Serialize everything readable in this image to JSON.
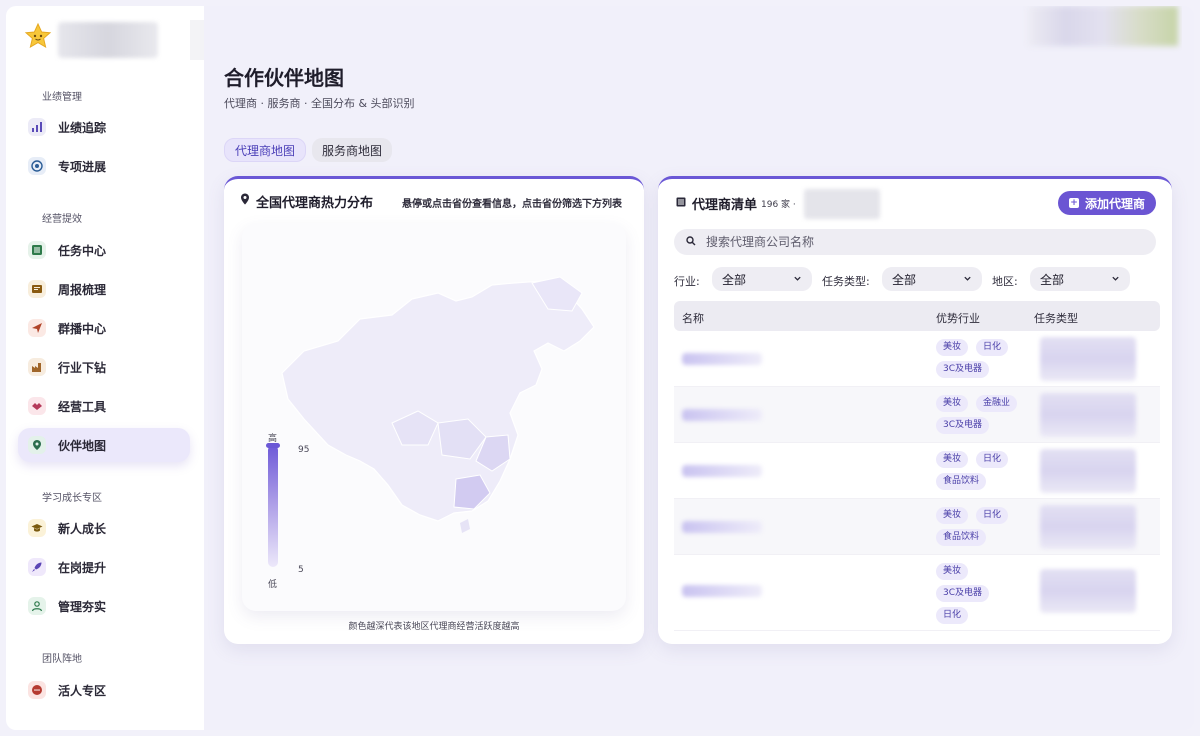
{
  "sidebar": {
    "sections": [
      {
        "label": "业绩管理"
      },
      {
        "label": "经营提效"
      },
      {
        "label": "学习成长专区"
      },
      {
        "label": "团队阵地"
      }
    ],
    "items": [
      {
        "label": "业绩追踪",
        "icon": "bar-chart-icon"
      },
      {
        "label": "专项进展",
        "icon": "target-icon"
      },
      {
        "label": "任务中心",
        "icon": "list-icon"
      },
      {
        "label": "周报梳理",
        "icon": "report-icon"
      },
      {
        "label": "群播中心",
        "icon": "send-icon"
      },
      {
        "label": "行业下钻",
        "icon": "factory-icon"
      },
      {
        "label": "经营工具",
        "icon": "handshake-icon"
      },
      {
        "label": "伙伴地图",
        "icon": "pin-icon"
      },
      {
        "label": "新人成长",
        "icon": "graduation-icon"
      },
      {
        "label": "在岗提升",
        "icon": "rocket-icon"
      },
      {
        "label": "管理夯实",
        "icon": "users-icon"
      },
      {
        "label": "活人专区",
        "icon": "chat-icon"
      }
    ],
    "active_item": "伙伴地图"
  },
  "header": {
    "title": "合作伙伴地图",
    "subtitle": "代理商 · 服务商 · 全国分布 & 头部识别"
  },
  "tabs": [
    {
      "label": "代理商地图",
      "active": true
    },
    {
      "label": "服务商地图",
      "active": false
    }
  ],
  "map_card": {
    "title": "全国代理商热力分布",
    "hint": "悬停或点击省份查看信息，点击省份筛选下方列表",
    "legend_high": "高",
    "legend_low": "低",
    "legend_max": "95",
    "legend_min": "5",
    "footer": "颜色越深代表该地区代理商经营活跃度越高"
  },
  "list_card": {
    "title": "代理商清单",
    "count": "196 家 ·",
    "add_button": "添加代理商",
    "search_placeholder": "搜索代理商公司名称",
    "filters": [
      {
        "label": "行业:",
        "value": "全部"
      },
      {
        "label": "任务类型:",
        "value": "全部"
      },
      {
        "label": "地区:",
        "value": "全部"
      }
    ],
    "columns": [
      "名称",
      "优势行业",
      "任务类型"
    ],
    "rows": [
      {
        "tags": [
          "美妆",
          "日化",
          "3C及电器"
        ]
      },
      {
        "tags": [
          "美妆",
          "金融业",
          "3C及电器"
        ]
      },
      {
        "tags": [
          "美妆",
          "日化",
          "食品饮料"
        ]
      },
      {
        "tags": [
          "美妆",
          "日化",
          "食品饮料"
        ]
      },
      {
        "tags": [
          "美妆",
          "3C及电器",
          "日化"
        ]
      }
    ]
  },
  "colors": {
    "accent": "#6b55d3",
    "tag_bg": "#ece9fb",
    "active_nav_bg": "#ebe8fb"
  }
}
